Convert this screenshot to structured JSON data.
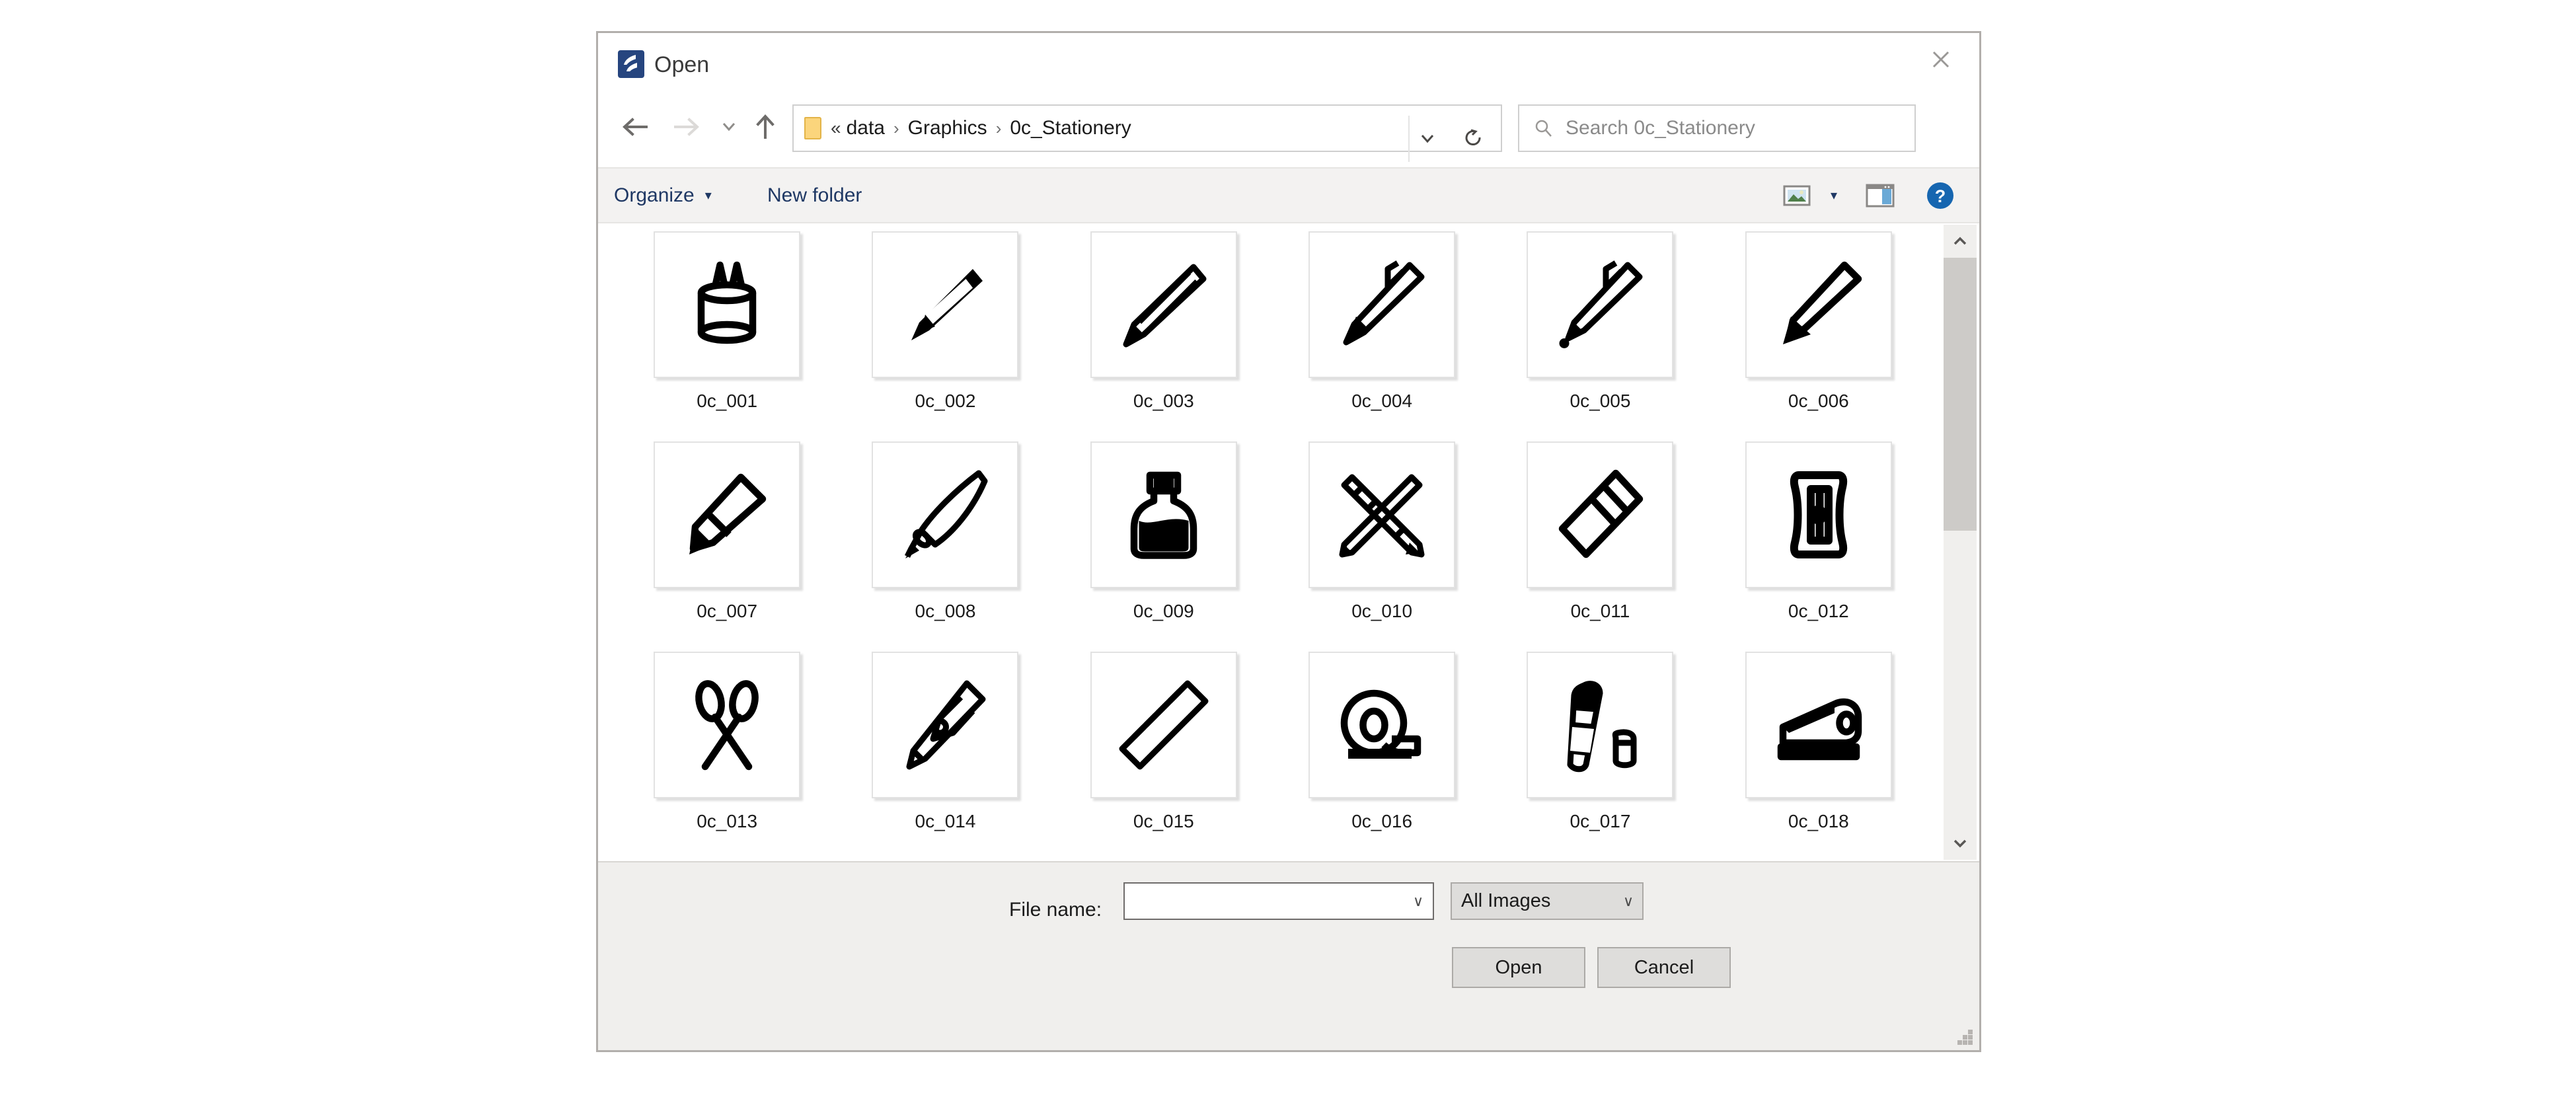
{
  "window": {
    "title": "Open",
    "app_icon": "layered-swirl-icon",
    "close_label": "close-icon"
  },
  "navigation": {
    "back": "back-arrow-icon",
    "forward": "forward-arrow-icon",
    "recent": "recent-locations-chevron-icon",
    "up": "up-arrow-icon",
    "back_enabled": true,
    "forward_enabled": false
  },
  "address": {
    "folder_icon": "folder-icon",
    "overflow": "«",
    "crumbs": [
      "data",
      "Graphics",
      "0c_Stationery"
    ],
    "separator": "›",
    "dropdown": "chevron-down-icon",
    "refresh": "refresh-icon"
  },
  "search": {
    "icon": "search-icon",
    "placeholder": "Search 0c_Stationery",
    "value": ""
  },
  "toolbar": {
    "organize_label": "Organize",
    "organize_caret": "▾",
    "new_folder_label": "New folder",
    "view_mode_icon": "view-thumbnails-icon",
    "view_caret": "▾",
    "preview_pane_icon": "preview-pane-icon",
    "help_icon": "help-icon"
  },
  "files": [
    {
      "label": "0c_001",
      "icon": "pencil-cup-icon"
    },
    {
      "label": "0c_002",
      "icon": "pencil-icon"
    },
    {
      "label": "0c_003",
      "icon": "striped-pencil-icon"
    },
    {
      "label": "0c_004",
      "icon": "pen-with-clip-icon"
    },
    {
      "label": "0c_005",
      "icon": "ballpoint-pen-icon"
    },
    {
      "label": "0c_006",
      "icon": "marker-icon"
    },
    {
      "label": "0c_007",
      "icon": "highlighter-icon"
    },
    {
      "label": "0c_008",
      "icon": "fountain-pen-icon"
    },
    {
      "label": "0c_009",
      "icon": "ink-bottle-icon"
    },
    {
      "label": "0c_010",
      "icon": "crossed-pencil-ruler-icon"
    },
    {
      "label": "0c_011",
      "icon": "eraser-icon"
    },
    {
      "label": "0c_012",
      "icon": "pencil-sharpener-icon"
    },
    {
      "label": "0c_013",
      "icon": "scissors-icon"
    },
    {
      "label": "0c_014",
      "icon": "box-cutter-icon"
    },
    {
      "label": "0c_015",
      "icon": "ruler-icon"
    },
    {
      "label": "0c_016",
      "icon": "tape-dispenser-icon"
    },
    {
      "label": "0c_017",
      "icon": "glue-stick-icon"
    },
    {
      "label": "0c_018",
      "icon": "stapler-icon"
    }
  ],
  "scrollbar": {
    "up_icon": "chevron-up-icon",
    "down_icon": "chevron-down-icon",
    "thumb_position": "top"
  },
  "footer": {
    "filename_label": "File name:",
    "filename_value": "",
    "filename_caret": "∨",
    "filetype_value": "All Images",
    "filetype_caret": "∨",
    "open_label": "Open",
    "cancel_label": "Cancel",
    "resize_grip": "resize-grip-icon"
  },
  "colors": {
    "accent_blue": "#1f3864",
    "app_icon_blue": "#26457f",
    "help_blue": "#1666b0",
    "folder_yellow": "#fbd57c",
    "chrome_gray": "#f0efed",
    "toolbar_gray": "#f3f2f1",
    "border_gray": "#b2afac"
  }
}
